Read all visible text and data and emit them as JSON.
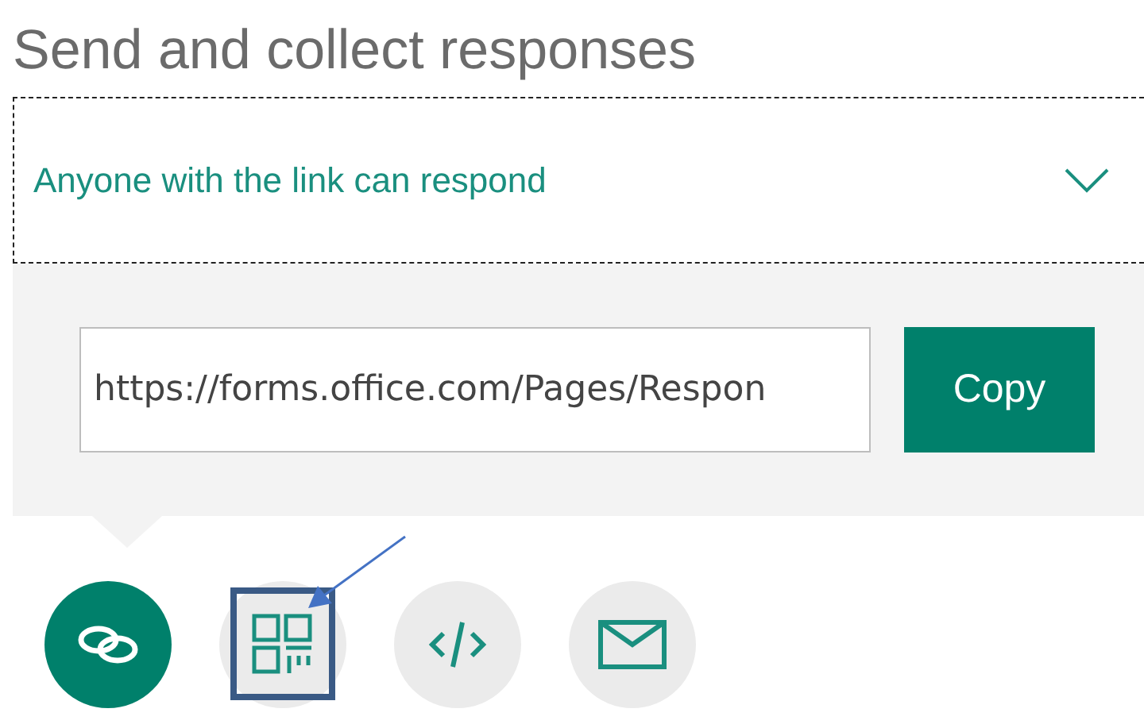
{
  "title": "Send and collect responses",
  "audience": {
    "value": "Anyone with the link can respond"
  },
  "link": {
    "value": "https://forms.office.com/Pages/Respon",
    "button": "Copy"
  },
  "share_options": [
    {
      "kind": "link",
      "selected": true,
      "highlighted": false
    },
    {
      "kind": "qr",
      "selected": false,
      "highlighted": true
    },
    {
      "kind": "embed",
      "selected": false,
      "highlighted": false
    },
    {
      "kind": "email",
      "selected": false,
      "highlighted": false
    }
  ]
}
